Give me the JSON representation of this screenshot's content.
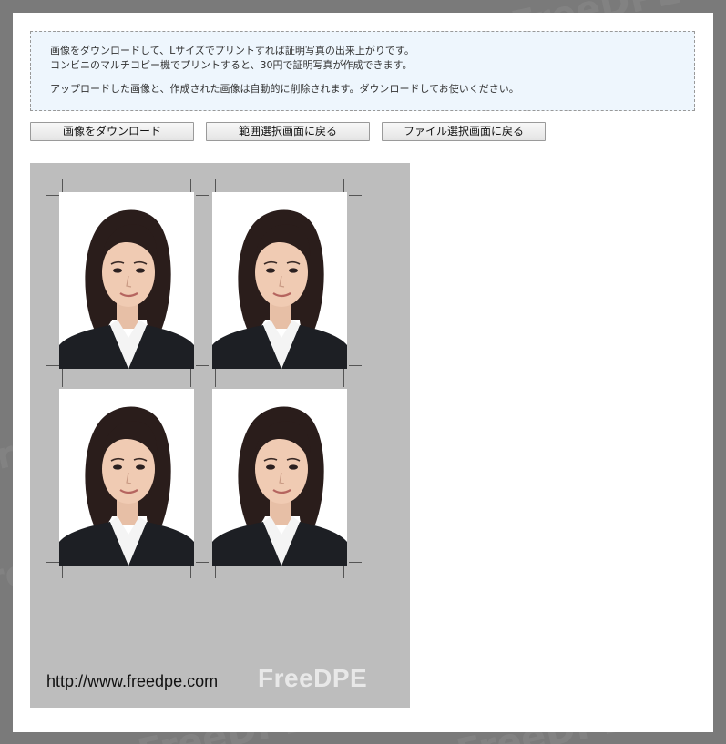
{
  "notice": {
    "line1": "画像をダウンロードして、Lサイズでプリントすれば証明写真の出来上がりです。",
    "line2": "コンビニのマルチコピー機でプリントすると、30円で証明写真が作成できます。",
    "line3": "アップロードした画像と、作成された画像は自動的に削除されます。ダウンロードしてお使いください。"
  },
  "buttons": {
    "download": "画像をダウンロード",
    "back_to_range": "範囲選択画面に戻る",
    "back_to_file": "ファイル選択画面に戻る"
  },
  "sheet": {
    "url": "http://www.freedpe.com",
    "logo": "FreeDPE",
    "photo_count": 4
  },
  "watermark": {
    "text": "FreeDPE"
  },
  "colors": {
    "page_background": "#7a7a7a",
    "notice_background": "#eef6fd",
    "sheet_background": "#bdbdbd"
  }
}
